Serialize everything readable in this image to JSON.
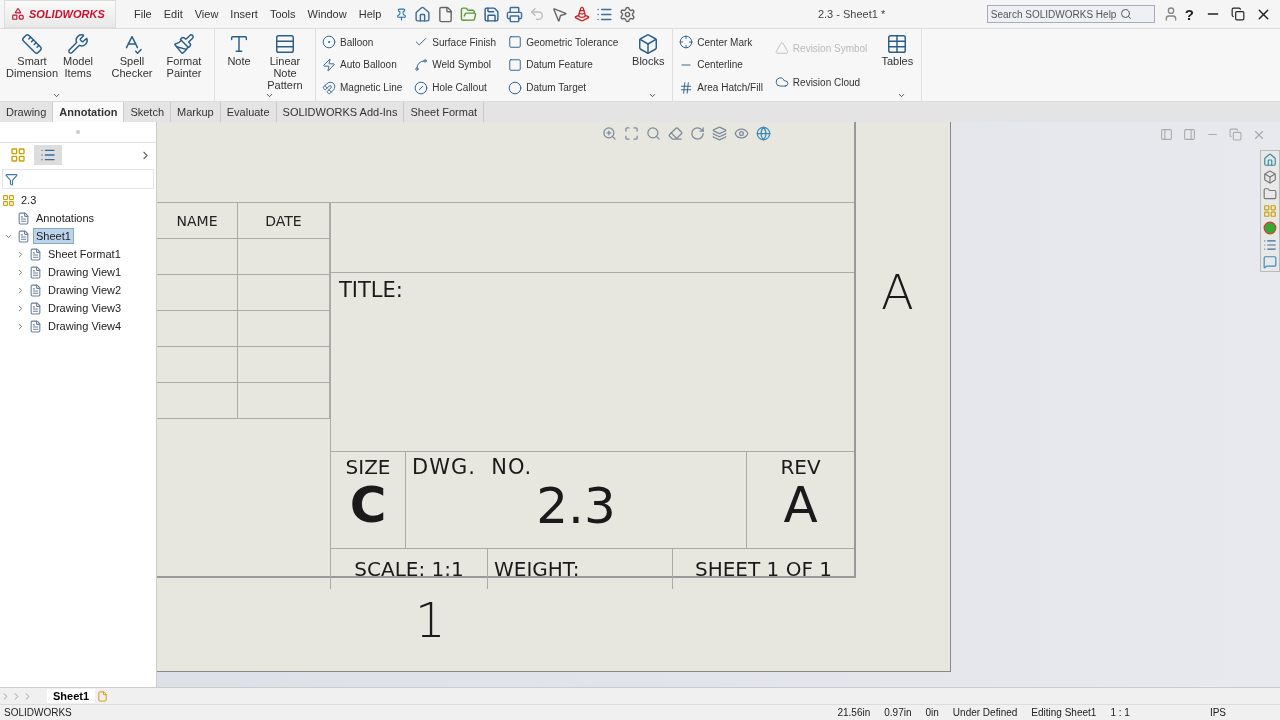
{
  "app": {
    "logo": "SOLIDWORKS"
  },
  "menu": [
    "File",
    "Edit",
    "View",
    "Insert",
    "Tools",
    "Window",
    "Help"
  ],
  "window": {
    "title": "2.3 - Sheet1 *"
  },
  "search": {
    "placeholder": "Search SOLIDWORKS Help"
  },
  "help_button": "?",
  "ribbon": [
    {
      "kind": "large",
      "menu": true,
      "items": [
        {
          "label": "Smart Dimension",
          "disabled": false
        },
        {
          "label": "Model Items",
          "disabled": false
        }
      ]
    },
    {
      "kind": "large",
      "menu": false,
      "items": [
        {
          "label": "Spell Checker",
          "disabled": false
        },
        {
          "label": "Format Painter",
          "disabled": false
        }
      ]
    },
    {
      "kind": "large",
      "menu": true,
      "items": [
        {
          "label": "Note",
          "disabled": false
        },
        {
          "label": "Linear Note Pattern",
          "disabled": false
        }
      ]
    },
    {
      "kind": "stack",
      "menu": false,
      "items": [
        {
          "label": "Balloon",
          "disabled": false
        },
        {
          "label": "Auto Balloon",
          "disabled": false
        },
        {
          "label": "Magnetic Line",
          "disabled": false
        }
      ]
    },
    {
      "kind": "stack",
      "menu": false,
      "items": [
        {
          "label": "Surface Finish",
          "disabled": false
        },
        {
          "label": "Weld Symbol",
          "disabled": false
        },
        {
          "label": "Hole Callout",
          "disabled": false
        }
      ]
    },
    {
      "kind": "stack",
      "menu": false,
      "items": [
        {
          "label": "Geometric Tolerance",
          "disabled": false
        },
        {
          "label": "Datum Feature",
          "disabled": false
        },
        {
          "label": "Datum Target",
          "disabled": false
        }
      ]
    },
    {
      "kind": "large",
      "menu": true,
      "items": [
        {
          "label": "Blocks",
          "disabled": false
        }
      ]
    },
    {
      "kind": "stack",
      "menu": false,
      "items": [
        {
          "label": "Center Mark",
          "disabled": false
        },
        {
          "label": "Centerline",
          "disabled": false
        },
        {
          "label": "Area Hatch/Fill",
          "disabled": false
        }
      ]
    },
    {
      "kind": "stack",
      "menu": false,
      "items": [
        {
          "label": "Revision Symbol",
          "disabled": true
        },
        {
          "label": "Revision Cloud",
          "disabled": false
        }
      ]
    },
    {
      "kind": "large",
      "menu": true,
      "items": [
        {
          "label": "Tables",
          "disabled": false
        }
      ]
    }
  ],
  "tabs": [
    {
      "label": "Drawing",
      "selected": false
    },
    {
      "label": "Annotation",
      "selected": true
    },
    {
      "label": "Sketch",
      "selected": false
    },
    {
      "label": "Markup",
      "selected": false
    },
    {
      "label": "Evaluate",
      "selected": false
    },
    {
      "label": "SOLIDWORKS Add-Ins",
      "selected": false
    },
    {
      "label": "Sheet Format",
      "selected": false
    }
  ],
  "tree": {
    "label": "2.3",
    "children": [
      {
        "label": "Annotations",
        "selected": false
      },
      {
        "label": "Sheet1",
        "selected": true,
        "expanded": true,
        "children": [
          {
            "label": "Sheet Format1",
            "selected": false,
            "expanded": false
          },
          {
            "label": "Drawing View1",
            "selected": false,
            "expanded": false
          },
          {
            "label": "Drawing View2",
            "selected": false,
            "expanded": false
          },
          {
            "label": "Drawing View3",
            "selected": false,
            "expanded": false
          },
          {
            "label": "Drawing View4",
            "selected": false,
            "expanded": false
          }
        ]
      }
    ]
  },
  "title_block": {
    "name_header": "NAME",
    "date_header": "DATE",
    "title_label": "TITLE:",
    "size_label": "SIZE",
    "size": "C",
    "dwg_no_label": "DWG.  NO.",
    "dwg_no": "2.3",
    "rev_label": "REV",
    "rev": "A",
    "scale": "SCALE: 1:1",
    "weight": "WEIGHT:",
    "sheet": "SHEET 1 OF 1"
  },
  "zones": {
    "row_label": "A",
    "column_label": "1"
  },
  "sheet_tabs": [
    {
      "label": "Sheet1",
      "selected": true
    }
  ],
  "status_bar": {
    "app": "SOLIDWORKS",
    "fields": [
      "21.56in",
      "0.97in",
      "0in",
      "Under Defined",
      "Editing Sheet1",
      "1 : 1"
    ],
    "units": "IPS"
  }
}
